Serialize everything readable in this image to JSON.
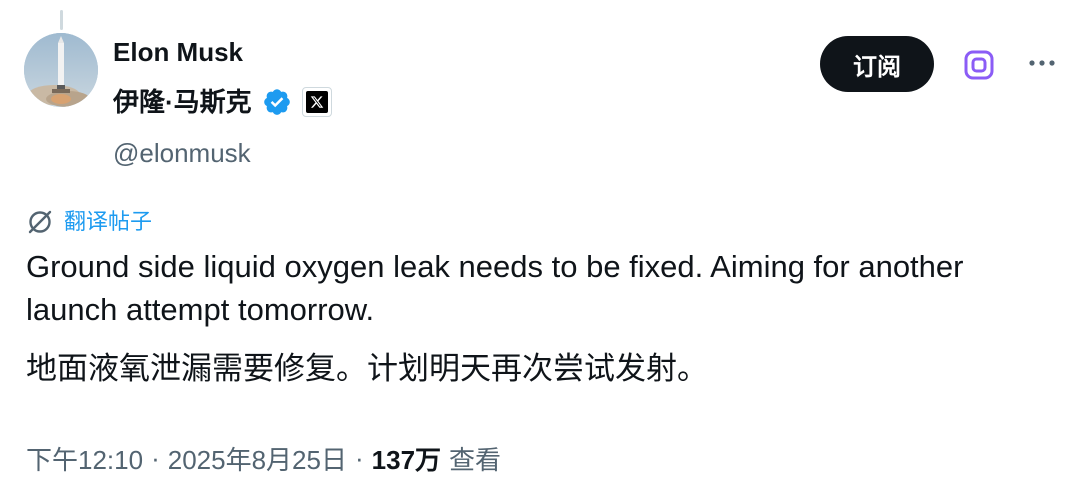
{
  "author": {
    "display_name": "Elon Musk",
    "display_name_zh": "伊隆·马斯克",
    "handle": "@elonmusk",
    "verified_color": "#1d9bf0",
    "avatar_icon": "rocket-photo"
  },
  "actions": {
    "subscribe_label": "订阅",
    "grok_icon": "grok-icon",
    "more_icon": "more-horizontal-icon"
  },
  "translate": {
    "label": "翻译帖子",
    "icon": "translate-icon"
  },
  "post": {
    "text_en": "Ground side liquid oxygen leak needs to be fixed. Aiming for another launch attempt tomorrow.",
    "text_zh": "地面液氧泄漏需要修复。计划明天再次尝试发射。"
  },
  "meta": {
    "time": "下午12:10",
    "date": "2025年8月25日",
    "separator": "·",
    "views_count": "137万",
    "views_label": "查看"
  }
}
